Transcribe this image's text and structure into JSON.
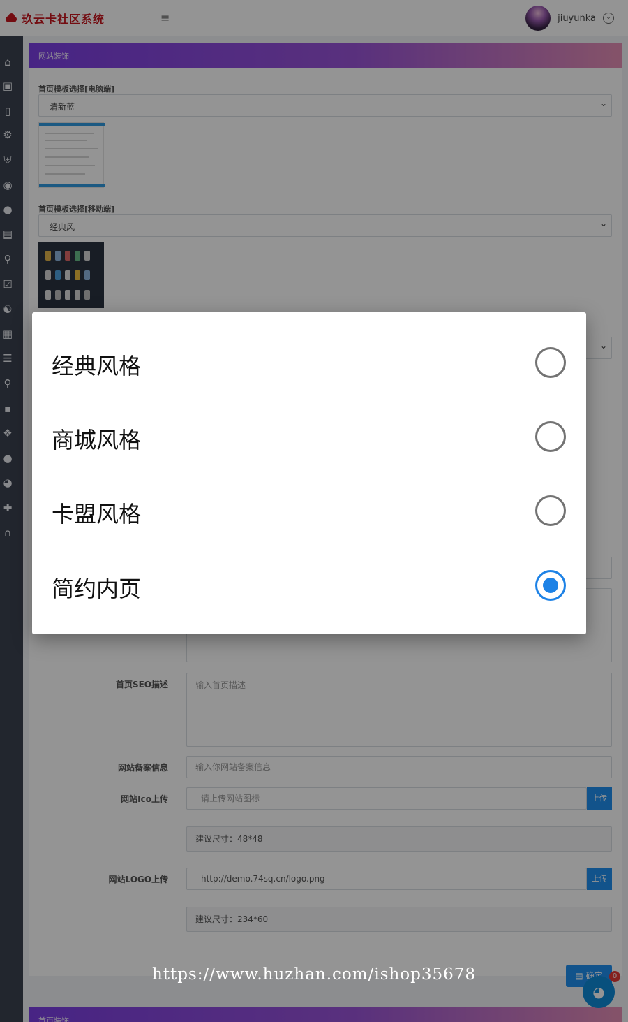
{
  "header": {
    "brand": "玖云卡社区系统",
    "menu_icon": "hamburger-icon",
    "username": "jiuyunka"
  },
  "sidebar": {
    "icons": [
      "home-gear-icon",
      "lock-icon",
      "phone-icon",
      "gear-icon",
      "shield-icon",
      "globe-icon",
      "qq-icon",
      "box-icon",
      "search-icon",
      "calendar-check-icon",
      "users-icon",
      "sitemap-icon",
      "list-icon",
      "key-icon",
      "chart-icon",
      "apps-icon",
      "apple-icon",
      "headset-icon",
      "wrench-icon",
      "au-icon"
    ]
  },
  "section": {
    "title": "网站装饰",
    "pc_template_label": "首页模板选择[电脑端]",
    "pc_template_value": "清新蓝",
    "mobile_template_label": "首页模板选择[移动端]",
    "mobile_template_value": "经典风"
  },
  "form": {
    "seo_desc_label": "首页SEO描述",
    "seo_desc_placeholder": "输入首页描述",
    "icp_label": "网站备案信息",
    "icp_placeholder": "输入你网站备案信息",
    "ico_label": "网站Ico上传",
    "ico_placeholder": "请上传网站图标",
    "upload_label": "上传",
    "ico_hint": "建议尺寸：48*48",
    "logo_label": "网站LOGO上传",
    "logo_value": "http://demo.74sq.cn/logo.png",
    "logo_hint": "建议尺寸：234*60",
    "confirm_label": "确定",
    "fab_badge": "0"
  },
  "next_section": {
    "title": "首页装饰"
  },
  "dialog": {
    "options": [
      {
        "label": "经典风格",
        "selected": false
      },
      {
        "label": "商城风格",
        "selected": false
      },
      {
        "label": "卡盟风格",
        "selected": false
      },
      {
        "label": "简约内页",
        "selected": true
      }
    ]
  },
  "watermark": "https://www.huzhan.com/ishop35678",
  "colors": {
    "brand_red": "#c7161e",
    "header_gradient_start": "#7b3fe4",
    "header_gradient_end": "#e58fb5",
    "radio_selected": "#1d82e6",
    "sidebar_bg": "#3b4250",
    "button_blue": "#1f8ff0"
  }
}
